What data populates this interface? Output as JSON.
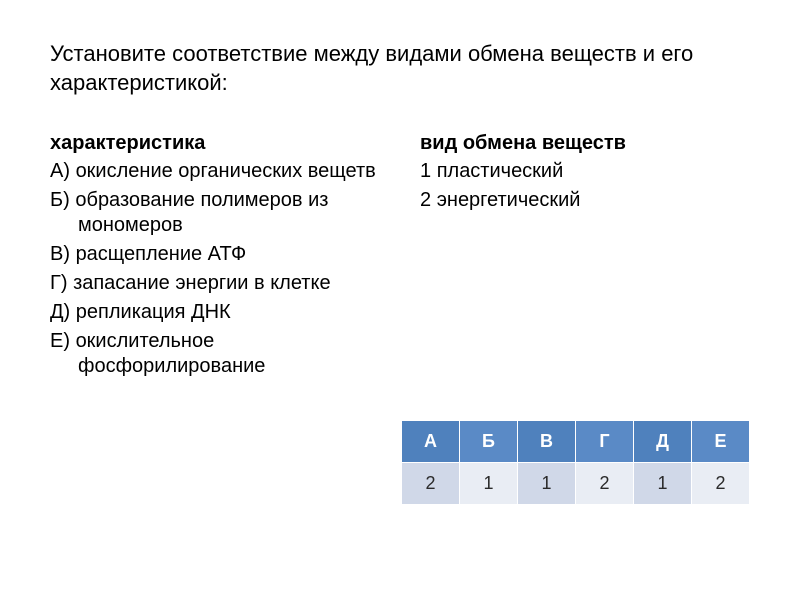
{
  "title": "Установите соответствие между видами обмена веществ и его характеристикой:",
  "left": {
    "heading": "характеристика",
    "items": [
      {
        "letter": "А)",
        "text": "окисление органических вещетв"
      },
      {
        "letter": "Б)",
        "text": "образование полимеров из мономеров"
      },
      {
        "letter": "В)",
        "text": "расщепление АТФ"
      },
      {
        "letter": "Г)",
        "text": "запасание энергии в клетке"
      },
      {
        "letter": "Д)",
        "text": "репликация ДНК"
      },
      {
        "letter": "Е)",
        "text": "окислительное фосфорилирование"
      }
    ]
  },
  "right": {
    "heading": "вид обмена веществ",
    "items": [
      {
        "num": "1",
        "text": "пластический"
      },
      {
        "num": "2",
        "text": "энергетический"
      }
    ]
  },
  "answers": {
    "headers": [
      "А",
      "Б",
      "В",
      "Г",
      "Д",
      "Е"
    ],
    "values": [
      "2",
      "1",
      "1",
      "2",
      "1",
      "2"
    ]
  },
  "chart_data": {
    "type": "table",
    "columns": [
      "А",
      "Б",
      "В",
      "Г",
      "Д",
      "Е"
    ],
    "rows": [
      [
        "2",
        "1",
        "1",
        "2",
        "1",
        "2"
      ]
    ]
  }
}
